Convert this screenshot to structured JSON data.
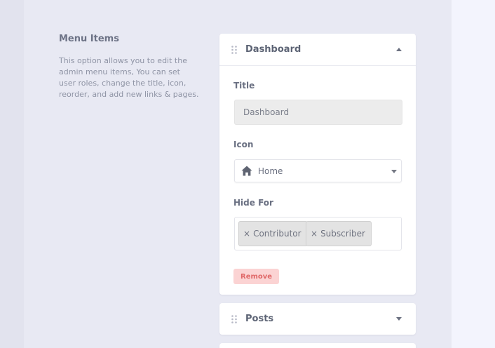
{
  "section": {
    "title": "Menu Items",
    "description": "This option allows you to edit the admin menu items, You can set user roles, change the title, icon, reorder, and add new links & pages."
  },
  "items": [
    {
      "title": "Dashboard",
      "expanded": true,
      "fields": {
        "title_label": "Title",
        "title_value": "Dashboard",
        "icon_label": "Icon",
        "icon_icon": "home-icon",
        "icon_value": "Home",
        "hide_label": "Hide For",
        "hide_tags": [
          "Contributor",
          "Subscriber"
        ],
        "remove_label": "Remove"
      }
    },
    {
      "title": "Posts",
      "expanded": false
    }
  ],
  "colors": {
    "remove_bg": "#fbd3d3",
    "remove_text": "#e06767"
  }
}
